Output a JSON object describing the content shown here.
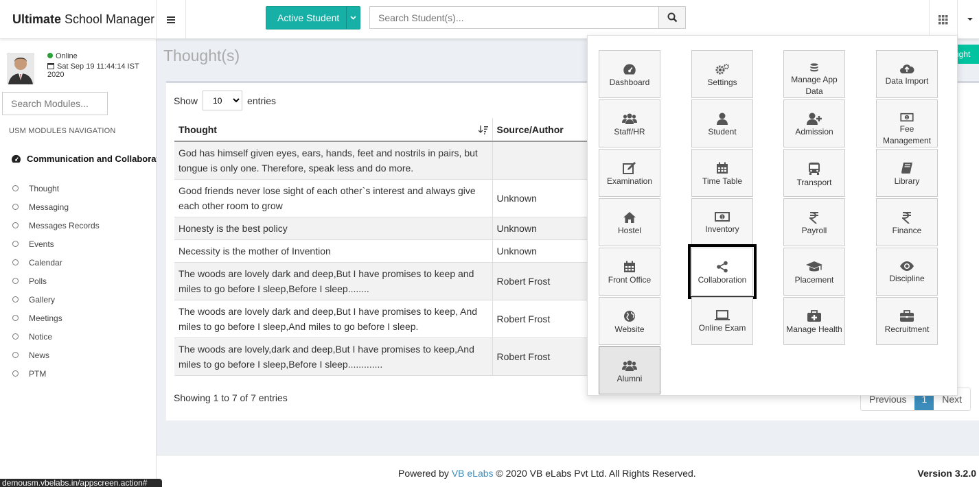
{
  "brand": {
    "bold": "Ultimate",
    "rest": " School Manager"
  },
  "topbar": {
    "active_student": "Active Student",
    "search_placeholder": "Search Student(s)..."
  },
  "user": {
    "status": "Online",
    "datetime": "Sat Sep 19 11:44:14 IST 2020"
  },
  "sidebar": {
    "search_placeholder": "Search Modules...",
    "nav_heading": "USM MODULES NAVIGATION",
    "group": "Communication and Collaboration",
    "items": [
      "Thought",
      "Messaging",
      "Messages Records",
      "Events",
      "Calendar",
      "Polls",
      "Gallery",
      "Meetings",
      "Notice",
      "News",
      "PTM"
    ]
  },
  "page": {
    "title": "Thought(s)",
    "add_button_partial": "ught"
  },
  "table": {
    "show_label": "Show",
    "entries_label": "entries",
    "page_size": "10",
    "columns": [
      "Thought",
      "Source/Author"
    ],
    "rows": [
      [
        "God has himself given eyes, ears, hands, feet and nostrils in pairs, but tongue is only one. Therefore, speak less and do more.",
        ""
      ],
      [
        "Good friends never lose sight of each other`s interest and always give each other room to grow",
        "Unknown"
      ],
      [
        "Honesty is the best policy",
        "Unknown"
      ],
      [
        "Necessity is the mother of Invention",
        "Unknown"
      ],
      [
        "The woods are lovely dark and deep,But I have promises to keep and miles to go before I sleep,Before I sleep........",
        "Robert Frost"
      ],
      [
        "The woods are lovely dark and deep,But I have promises to keep, And miles to go before I sleep,And miles to go before I sleep.",
        "Robert Frost"
      ],
      [
        "The woods are lovely,dark and deep,But I have promises to keep,And miles to go before I sleep,Before I sleep.............",
        "Robert Frost"
      ]
    ],
    "showing": "Showing 1 to 7 of 7 entries",
    "pager": {
      "previous": "Previous",
      "current": "1",
      "next": "Next"
    }
  },
  "apps": [
    {
      "label": "Dashboard",
      "icon": "dashboard-icon"
    },
    {
      "label": "Settings",
      "icon": "gears-icon"
    },
    {
      "label": "Manage App Data",
      "icon": "database-icon"
    },
    {
      "label": "Data Import",
      "icon": "cloud-upload-icon"
    },
    {
      "label": "Staff/HR",
      "icon": "users-icon"
    },
    {
      "label": "Student",
      "icon": "user-icon"
    },
    {
      "label": "Admission",
      "icon": "user-plus-icon"
    },
    {
      "label": "Fee Management",
      "icon": "money-icon"
    },
    {
      "label": "Examination",
      "icon": "edit-icon"
    },
    {
      "label": "Time Table",
      "icon": "calendar-icon"
    },
    {
      "label": "Transport",
      "icon": "bus-icon"
    },
    {
      "label": "Library",
      "icon": "book-icon"
    },
    {
      "label": "Hostel",
      "icon": "home-icon"
    },
    {
      "label": "Inventory",
      "icon": "money-icon"
    },
    {
      "label": "Payroll",
      "icon": "rupee-icon"
    },
    {
      "label": "Finance",
      "icon": "rupee-icon"
    },
    {
      "label": "Front Office",
      "icon": "calendar-icon"
    },
    {
      "label": "Collaboration",
      "icon": "share-icon"
    },
    {
      "label": "Placement",
      "icon": "graduation-cap-icon"
    },
    {
      "label": "Discipline",
      "icon": "eye-icon"
    },
    {
      "label": "Website",
      "icon": "globe-icon"
    },
    {
      "label": "Online Exam",
      "icon": "laptop-icon"
    },
    {
      "label": "Manage Health",
      "icon": "medkit-icon"
    },
    {
      "label": "Recruitment",
      "icon": "briefcase-icon"
    },
    {
      "label": "Alumni",
      "icon": "users-icon"
    }
  ],
  "footer": {
    "powered": "Powered by ",
    "vb_link": "VB eLabs",
    "copyright": " © 2020 VB eLabs Pvt Ltd. All Rights Reserved.",
    "version": "Version 3.2.0"
  },
  "status_url": "demousm.vbelabs.in/appscreen.action#",
  "colors": {
    "accent": "#17b0a7",
    "link": "#3c8dbc",
    "online": "#2b9f3a",
    "content_bg": "#ecf0f5"
  }
}
